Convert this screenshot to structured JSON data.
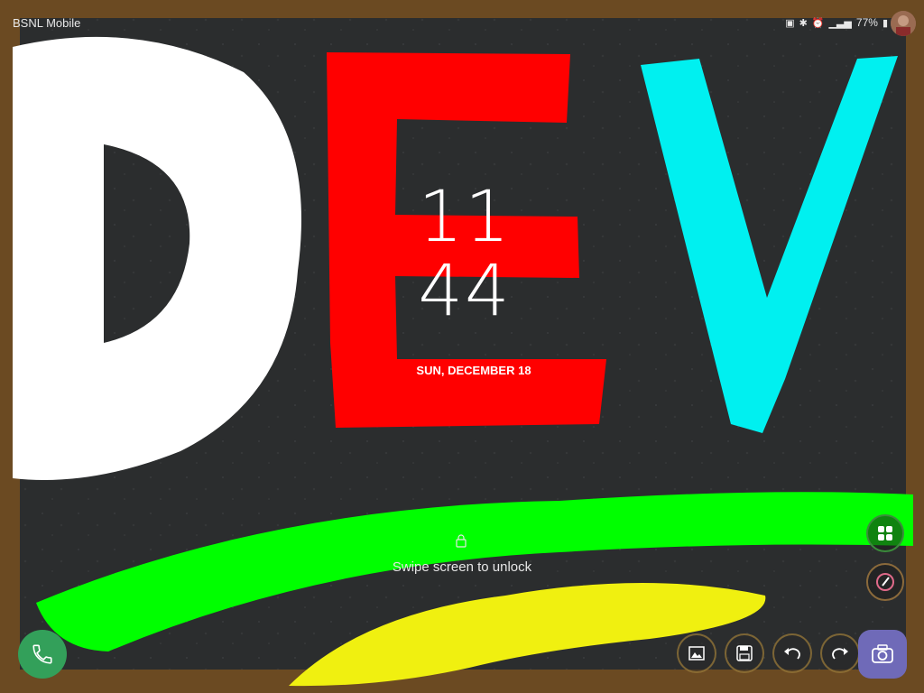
{
  "status_bar": {
    "carrier": "BSNL Mobile",
    "battery": "77%",
    "icons": [
      "sim-card-icon",
      "bluetooth-icon",
      "alarm-icon",
      "signal-icon",
      "battery-icon"
    ]
  },
  "lock_screen": {
    "hour": "11",
    "minute": "44",
    "date": "SUN, DECEMBER 18",
    "unlock_hint": "Swipe screen to unlock"
  },
  "wallpaper": {
    "letters": [
      "D",
      "E",
      "V"
    ],
    "colors": {
      "board": "#2b2d2e",
      "frame": "#6b4a22",
      "letter_d": "#ffffff",
      "letter_e": "#ff0000",
      "letter_v": "#00f0f0",
      "stroke_green": "#00ff00",
      "stroke_yellow": "#f0f010"
    }
  },
  "shortcuts": {
    "left": "phone-icon",
    "right": "camera-icon",
    "edge": [
      "apps-icon",
      "pen-icon"
    ],
    "tools": [
      "gallery-icon",
      "save-icon",
      "undo-icon",
      "redo-icon"
    ]
  }
}
